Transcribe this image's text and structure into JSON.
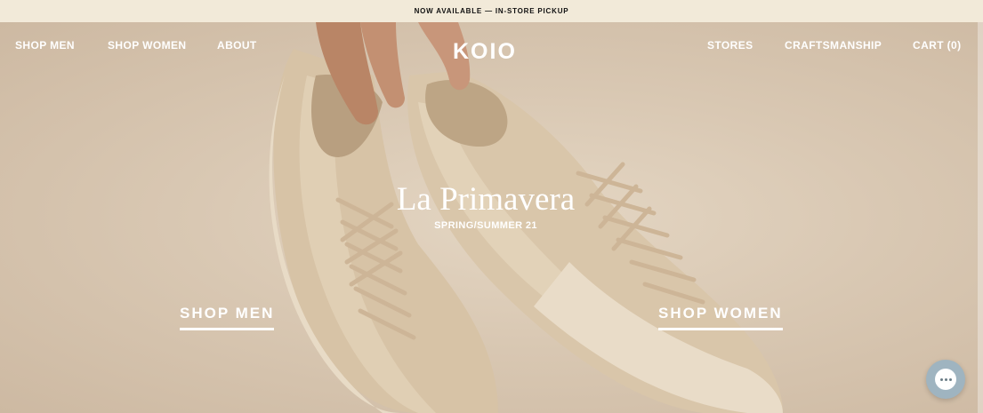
{
  "announcement": "NOW AVAILABLE — IN-STORE PICKUP",
  "nav": {
    "left": [
      "SHOP MEN",
      "SHOP WOMEN",
      "ABOUT"
    ],
    "logo": "KOIO",
    "right": [
      "STORES",
      "CRAFTSMANSHIP",
      "CART (0)"
    ]
  },
  "hero": {
    "title": "La Primavera",
    "subtitle": "SPRING/SUMMER 21",
    "cta_men": "SHOP MEN",
    "cta_women": "SHOP WOMEN"
  },
  "icons": {
    "chat": "chat-bubble-icon"
  },
  "colors": {
    "announcement_bg": "#f2ead9",
    "hero_bg": "#d8c6b0",
    "text": "#ffffff",
    "chat_bg": "#9fb4c0"
  }
}
